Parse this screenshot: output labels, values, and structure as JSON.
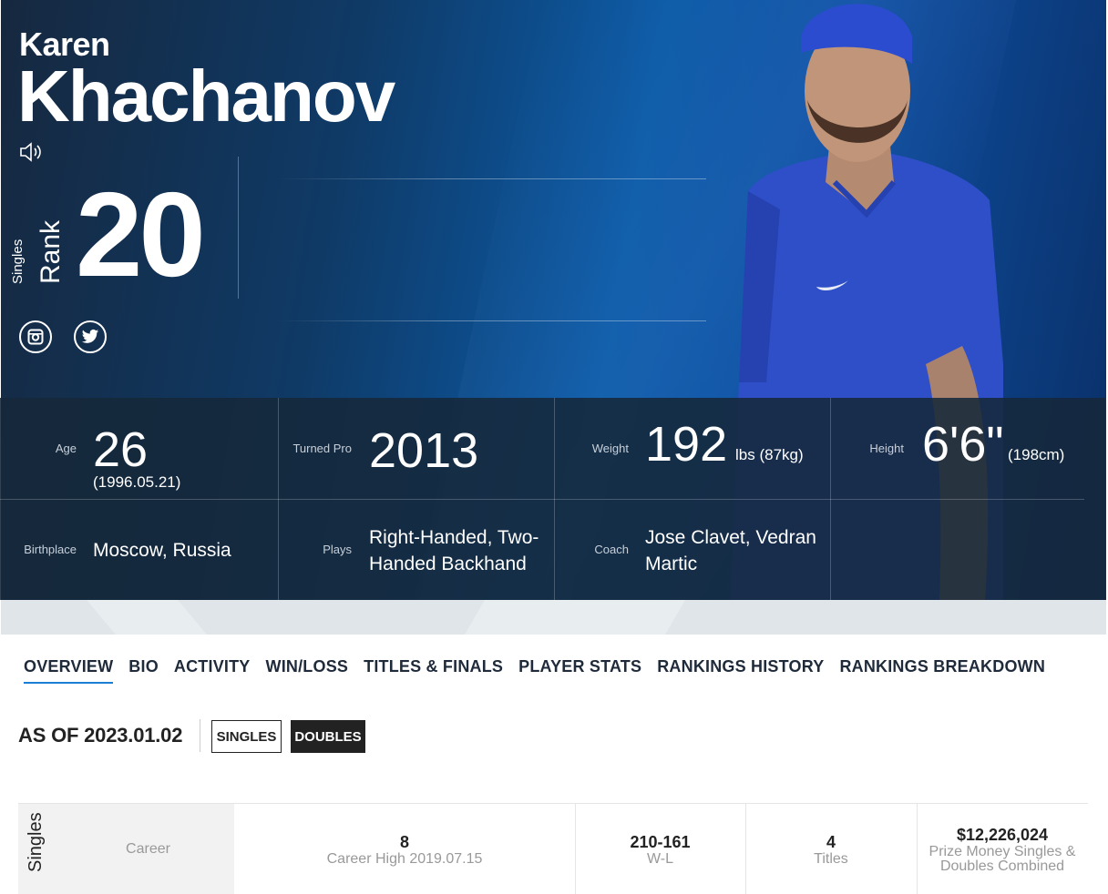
{
  "player": {
    "first_name": "Karen",
    "last_name": "Khachanov",
    "rank_type": "Singles",
    "rank_word": "Rank",
    "rank": "20"
  },
  "stats": {
    "age_label": "Age",
    "age": "26",
    "dob": "(1996.05.21)",
    "turned_pro_label": "Turned Pro",
    "turned_pro": "2013",
    "weight_label": "Weight",
    "weight": "192",
    "weight_unit": "lbs (87kg)",
    "height_label": "Height",
    "height": "6'6\"",
    "height_metric": "(198cm)",
    "birthplace_label": "Birthplace",
    "birthplace": "Moscow, Russia",
    "plays_label": "Plays",
    "plays_line1": "Right-Handed, Two-",
    "plays_line2": "Handed Backhand",
    "coach_label": "Coach",
    "coach_line1": "Jose Clavet, Vedran",
    "coach_line2": "Martic"
  },
  "tabs": [
    "OVERVIEW",
    "BIO",
    "ACTIVITY",
    "WIN/LOSS",
    "TITLES & FINALS",
    "PLAYER STATS",
    "RANKINGS HISTORY",
    "RANKINGS BREAKDOWN"
  ],
  "as_of": "AS OF 2023.01.02",
  "toggle": {
    "singles": "SINGLES",
    "doubles": "DOUBLES"
  },
  "career": {
    "row_label": "Singles",
    "career_label": "Career",
    "career_high": "8",
    "career_high_label": "Career High 2019.07.15",
    "wl": "210-161",
    "wl_label": "W-L",
    "titles": "4",
    "titles_label": "Titles",
    "prize": "$12,226,024",
    "prize_label_line1": "Prize Money Singles &",
    "prize_label_line2": "Doubles Combined"
  },
  "colors": {
    "accent": "#1a7ed4",
    "hero_dark": "#16283f",
    "hero_blue": "#0b5aa6"
  }
}
